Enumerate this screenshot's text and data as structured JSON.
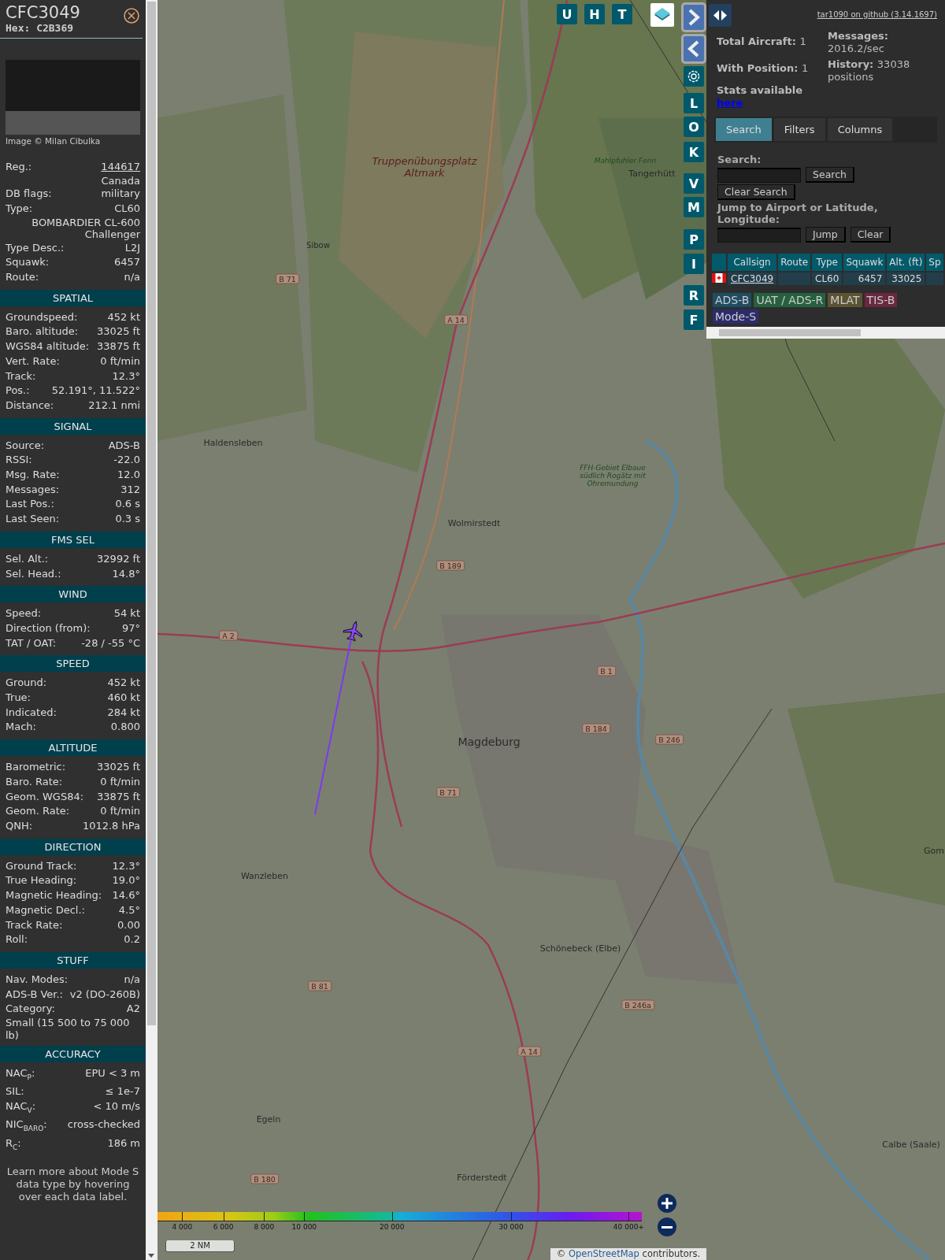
{
  "aircraft": {
    "callsign": "CFC3049",
    "hex_label": "Hex:",
    "hex": "C2B369",
    "photo_credit": "Image © Milan Cibulka"
  },
  "general_rows": [
    {
      "kind": "link",
      "label": "Reg.:",
      "value": "144617"
    },
    {
      "kind": "value",
      "value": "Canada"
    },
    {
      "kind": "pair",
      "label": "DB flags:",
      "value": "military"
    },
    {
      "kind": "pair",
      "label": "Type:",
      "value": "CL60"
    },
    {
      "kind": "value",
      "value": "BOMBARDIER CL-600 Challenger"
    },
    {
      "kind": "pair",
      "label": "Type Desc.:",
      "value": "L2J"
    },
    {
      "kind": "pair",
      "label": "Squawk:",
      "value": "6457"
    },
    {
      "kind": "pair",
      "label": "Route:",
      "value": "n/a"
    }
  ],
  "sections": [
    {
      "title": "SPATIAL",
      "rows": [
        {
          "kind": "pair",
          "label": "Groundspeed:",
          "value": "452 kt"
        },
        {
          "kind": "pair",
          "label": "Baro. altitude:",
          "value": "33025 ft"
        },
        {
          "kind": "pair",
          "label": "WGS84 altitude:",
          "value": "33875 ft"
        },
        {
          "kind": "pair",
          "label": "Vert. Rate:",
          "value": "0 ft/min"
        },
        {
          "kind": "pair",
          "label": "Track:",
          "value": "12.3°"
        },
        {
          "kind": "pair",
          "label": "Pos.:",
          "value": "52.191°, 11.522°"
        },
        {
          "kind": "pair",
          "label": "Distance:",
          "value": "212.1 nmi"
        }
      ]
    },
    {
      "title": "SIGNAL",
      "rows": [
        {
          "kind": "pair",
          "label": "Source:",
          "value": "ADS-B"
        },
        {
          "kind": "pair",
          "label": "RSSI:",
          "value": "-22.0"
        },
        {
          "kind": "pair",
          "label": "Msg. Rate:",
          "value": "12.0"
        },
        {
          "kind": "pair",
          "label": "Messages:",
          "value": "312"
        },
        {
          "kind": "pair",
          "label": "Last Pos.:",
          "value": "0.6 s"
        },
        {
          "kind": "pair",
          "label": "Last Seen:",
          "value": "0.3 s"
        }
      ]
    },
    {
      "title": "FMS SEL",
      "rows": [
        {
          "kind": "pair",
          "label": "Sel. Alt.:",
          "value": "32992 ft"
        },
        {
          "kind": "pair",
          "label": "Sel. Head.:",
          "value": "14.8°"
        }
      ]
    },
    {
      "title": "WIND",
      "rows": [
        {
          "kind": "pair",
          "label": "Speed:",
          "value": "54 kt"
        },
        {
          "kind": "pair",
          "label": "Direction (from):",
          "value": "97°"
        },
        {
          "kind": "pair",
          "label": "TAT / OAT:",
          "value": "-28 / -55 °C"
        }
      ]
    },
    {
      "title": "SPEED",
      "rows": [
        {
          "kind": "pair",
          "label": "Ground:",
          "value": "452 kt"
        },
        {
          "kind": "pair",
          "label": "True:",
          "value": "460 kt"
        },
        {
          "kind": "pair",
          "label": "Indicated:",
          "value": "284 kt"
        },
        {
          "kind": "pair",
          "label": "Mach:",
          "value": "0.800"
        }
      ]
    },
    {
      "title": "ALTITUDE",
      "rows": [
        {
          "kind": "pair",
          "label": "Barometric:",
          "value": "33025 ft"
        },
        {
          "kind": "pair",
          "label": "Baro. Rate:",
          "value": "0 ft/min"
        },
        {
          "kind": "pair",
          "label": "Geom. WGS84:",
          "value": "33875 ft"
        },
        {
          "kind": "pair",
          "label": "Geom. Rate:",
          "value": "0 ft/min"
        },
        {
          "kind": "pair",
          "label": "QNH:",
          "value": "1012.8 hPa"
        }
      ]
    },
    {
      "title": "DIRECTION",
      "rows": [
        {
          "kind": "pair",
          "label": "Ground Track:",
          "value": "12.3°"
        },
        {
          "kind": "pair",
          "label": "True Heading:",
          "value": "19.0°"
        },
        {
          "kind": "pair",
          "label": "Magnetic Heading:",
          "value": "14.6°"
        },
        {
          "kind": "pair",
          "label": "Magnetic Decl.:",
          "value": "4.5°"
        },
        {
          "kind": "pair",
          "label": "Track Rate:",
          "value": "0.00"
        },
        {
          "kind": "pair",
          "label": "Roll:",
          "value": "0.2"
        }
      ]
    },
    {
      "title": "STUFF",
      "rows": [
        {
          "kind": "pair",
          "label": "Nav. Modes:",
          "value": "n/a"
        },
        {
          "kind": "pair",
          "label": "ADS-B Ver.:",
          "value": "v2 (DO-260B)"
        },
        {
          "kind": "pair",
          "label": "Category:",
          "value": "A2"
        },
        {
          "kind": "note",
          "value": "Small (15 500 to 75 000 lb)"
        }
      ]
    },
    {
      "title": "ACCURACY",
      "rows": [
        {
          "kind": "pair",
          "label": "NAC$_{P}$:",
          "value": "EPU < 3 m"
        },
        {
          "kind": "pair",
          "label": "SIL:",
          "value": "≤ 1e-7"
        },
        {
          "kind": "pair",
          "label": "NAC$_{V}$:",
          "value": "< 10 m/s"
        },
        {
          "kind": "pair",
          "label": "NIC$_{BARO}$:",
          "value": "cross-checked"
        },
        {
          "kind": "pair",
          "label": "R$_{C}$:",
          "value": "186 m"
        }
      ]
    }
  ],
  "footer": "Learn more about Mode S data type by hovering over each data label.",
  "map": {
    "places": [
      {
        "name": "Truppenübungsplatz Altmark",
        "kind": "area"
      },
      {
        "name": "Mahlpfuhler Fenn",
        "kind": "nature"
      },
      {
        "name": "Tangerhütt",
        "kind": "town"
      },
      {
        "name": "Sibow",
        "kind": "village"
      },
      {
        "name": "Haldensleben",
        "kind": "town"
      },
      {
        "name": "FFH-Gebiet Elbaue südlich Rogätz mit Ohremundung",
        "kind": "nature"
      },
      {
        "name": "Wolmirstedt",
        "kind": "town"
      },
      {
        "name": "Magdeburg",
        "kind": "city"
      },
      {
        "name": "Gom",
        "kind": "town"
      },
      {
        "name": "Wanzleben",
        "kind": "town"
      },
      {
        "name": "Schönebeck (Elbe)",
        "kind": "town"
      },
      {
        "name": "Calbe (Saale)",
        "kind": "town"
      },
      {
        "name": "Egeln",
        "kind": "town"
      },
      {
        "name": "Förderstedt",
        "kind": "town"
      }
    ],
    "road_shields": [
      "B 71",
      "A 14",
      "B 189",
      "A 2",
      "B 1",
      "B 184",
      "B 246",
      "B 71",
      "B 81",
      "B 246a",
      "A 14",
      "B 180"
    ],
    "top_buttons": [
      "U",
      "H",
      "T"
    ],
    "side_buttons": [
      {
        "kind": "next"
      },
      {
        "kind": "prev"
      },
      {
        "kind": "settings"
      },
      {
        "kind": "letter",
        "label": "L"
      },
      {
        "kind": "letter",
        "label": "O"
      },
      {
        "kind": "letter",
        "label": "K"
      },
      {
        "kind": "letter",
        "label": "V"
      },
      {
        "kind": "letter",
        "label": "M"
      },
      {
        "kind": "letter",
        "label": "P"
      },
      {
        "kind": "letter",
        "label": "I"
      },
      {
        "kind": "letter",
        "label": "R"
      },
      {
        "kind": "letter",
        "label": "F"
      }
    ],
    "altitude_legend": [
      "4 000",
      "6 000",
      "8 000",
      "10 000",
      "20 000",
      "30 000",
      "40 000+"
    ],
    "scale": "2 NM",
    "attribution_prefix": "©",
    "attribution_link": "OpenStreetMap",
    "attribution_suffix": "contributors."
  },
  "panel": {
    "github_link": "tar1090 on github (3.14.1697)",
    "stats": [
      {
        "label": "Total Aircraft:",
        "value": "1"
      },
      {
        "label": "Messages:",
        "value": "2016.2/sec"
      },
      {
        "label": "With Position:",
        "value": "1"
      },
      {
        "label": "History:",
        "value": "33038 positions"
      }
    ],
    "stats_text": "Stats available",
    "stats_link": "here",
    "tabs": [
      {
        "label": "Search",
        "selected": true
      },
      {
        "label": "Filters",
        "selected": false
      },
      {
        "label": "Columns",
        "selected": false
      }
    ],
    "search_label": "Search:",
    "search_button": "Search",
    "clear_search_button": "Clear Search",
    "jump_label": "Jump to Airport or Latitude, Longitude:",
    "jump_button": "Jump",
    "clear_button": "Clear",
    "table": {
      "columns": [
        "",
        "Callsign",
        "Route",
        "Type",
        "Squawk",
        "Alt. (ft)",
        "Sp"
      ],
      "rows": [
        {
          "callsign": "CFC3049",
          "route": "",
          "type": "CL60",
          "squawk": "6457",
          "altitude": "33025",
          "speed": ""
        }
      ]
    },
    "legend": [
      {
        "label": "ADS-B",
        "color": "#1e4d62"
      },
      {
        "label": "UAT / ADS-R",
        "color": "#25613e"
      },
      {
        "label": "MLAT",
        "color": "#5c5333"
      },
      {
        "label": "TIS-B",
        "color": "#6a2840"
      },
      {
        "label": "Mode-S",
        "color": "#2c2c6c"
      }
    ]
  }
}
